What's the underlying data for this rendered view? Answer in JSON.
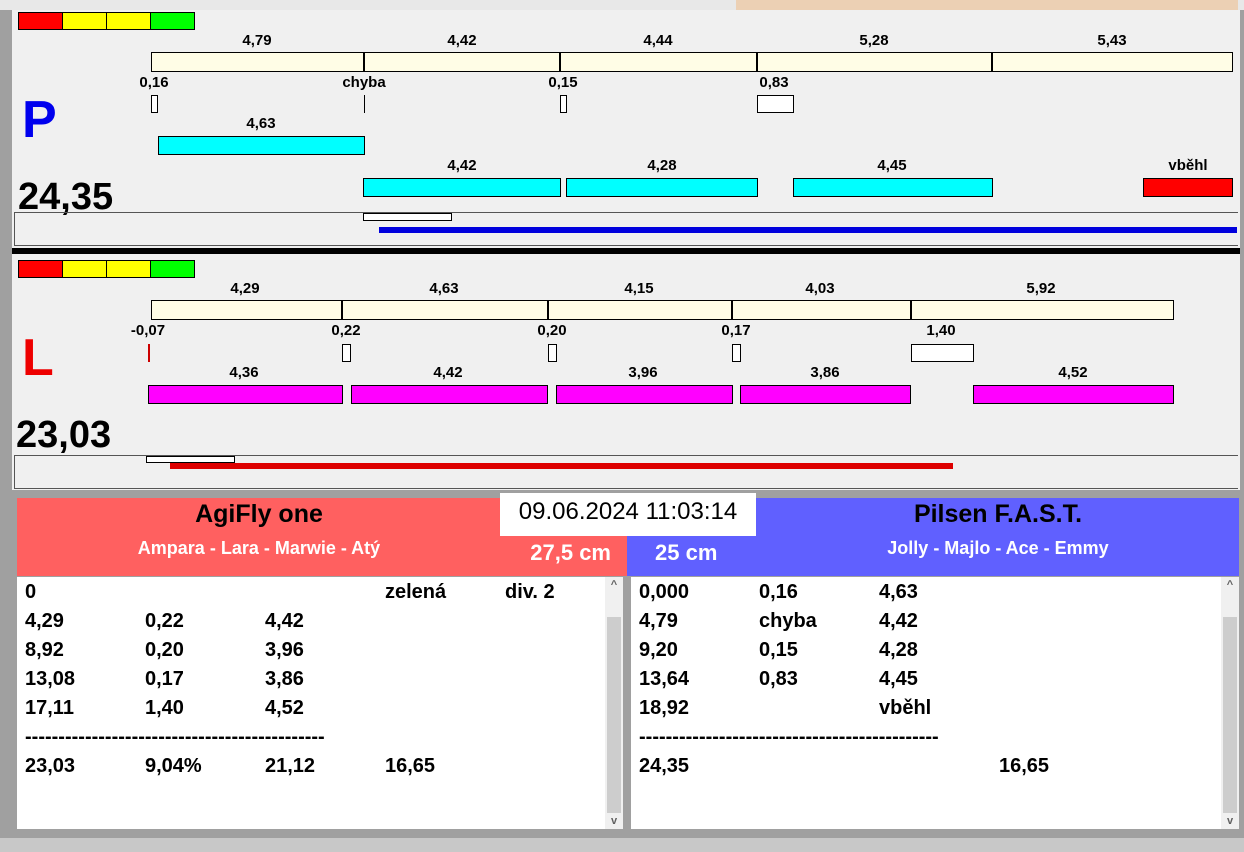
{
  "top": {
    "letter": "P",
    "total": "24,35",
    "splits": [
      "4,79",
      "4,42",
      "4,44",
      "5,28",
      "5,43"
    ],
    "changes": [
      "0,16",
      "chyba",
      "0,15",
      "0,83"
    ],
    "runs_row1": [
      "4,63"
    ],
    "runs_row2": [
      "4,42",
      "4,28",
      "4,45",
      "vběhl"
    ]
  },
  "bottom": {
    "letter": "L",
    "total": "23,03",
    "splits": [
      "4,29",
      "4,63",
      "4,15",
      "4,03",
      "5,92"
    ],
    "changes": [
      "-0,07",
      "0,22",
      "0,20",
      "0,17",
      "1,40"
    ],
    "runs": [
      "4,36",
      "4,42",
      "3,96",
      "3,86",
      "4,52"
    ]
  },
  "datetime": "09.06.2024 11:03:14",
  "left_team": {
    "name": "AgiFly one",
    "dogs": "Ampara - Lara - Marwie - Atý",
    "height": "27,5 cm",
    "color": "#ff6060",
    "rows": [
      [
        "0",
        "",
        "",
        "zelená",
        "div. 2"
      ],
      [
        "4,29",
        "0,22",
        "4,42",
        "",
        ""
      ],
      [
        "8,92",
        "0,20",
        "3,96",
        "",
        ""
      ],
      [
        "13,08",
        "0,17",
        "3,86",
        "",
        ""
      ],
      [
        "17,11",
        "1,40",
        "4,52",
        "",
        ""
      ],
      [
        "---------------------------------------------",
        "",
        "",
        "",
        ""
      ],
      [
        "23,03",
        "9,04%",
        "21,12",
        "16,65",
        ""
      ]
    ]
  },
  "right_team": {
    "name": "Pilsen F.A.S.T.",
    "dogs": "Jolly - Majlo - Ace - Emmy",
    "height": "25 cm",
    "color": "#6060ff",
    "rows": [
      [
        "0,000",
        "0,16",
        "4,63",
        "",
        ""
      ],
      [
        "4,79",
        "chyba",
        "4,42",
        "",
        ""
      ],
      [
        "9,20",
        "0,15",
        "4,28",
        "",
        ""
      ],
      [
        "13,64",
        "0,83",
        "4,45",
        "",
        ""
      ],
      [
        "18,92",
        "",
        "vběhl",
        "",
        ""
      ],
      [
        "---------------------------------------------",
        "",
        "",
        "",
        ""
      ],
      [
        "24,35",
        "",
        "",
        "16,65",
        ""
      ]
    ]
  }
}
